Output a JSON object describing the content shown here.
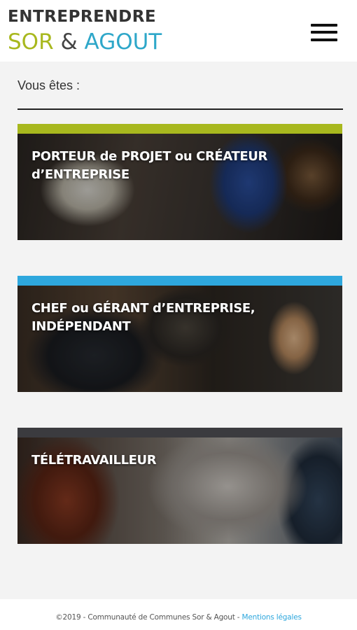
{
  "header": {
    "logo_line1": "ENTREPRENDRE",
    "logo_sor": "SOR",
    "logo_amp": "&",
    "logo_agout": "AGOUT",
    "menu_icon": "hamburger-menu-icon"
  },
  "main": {
    "prompt": "Vous êtes :",
    "cards": [
      {
        "label": "PORTEUR de PROJET ou CRÉATEUR d’ENTREPRISE",
        "accent": "#a8b81e"
      },
      {
        "label": "CHEF ou GÉRANT d’ENTREPRISE, INDÉPENDANT",
        "accent": "#2ea7dd"
      },
      {
        "label": "TÉLÉTRAVAILLEUR",
        "accent": "#3b3b3f"
      }
    ]
  },
  "footer": {
    "copyright": "©2019 - Communauté de Communes Sor & Agout - ",
    "legal_link": "Mentions légales"
  },
  "colors": {
    "brand_green": "#a8b81e",
    "brand_blue": "#2ea7dd"
  }
}
